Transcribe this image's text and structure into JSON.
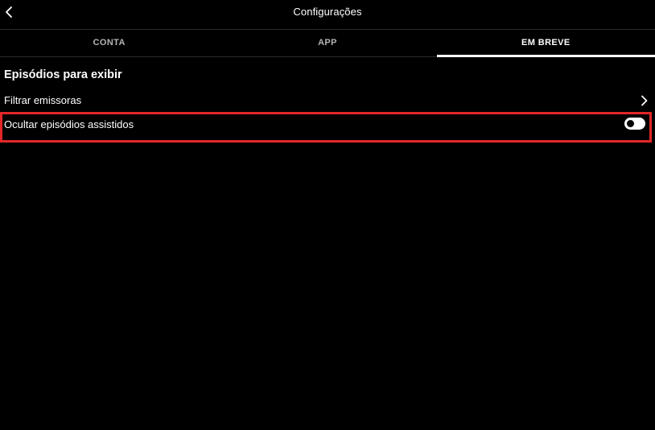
{
  "header": {
    "title": "Configurações",
    "back_icon": "chevron-left-icon"
  },
  "tabs": [
    {
      "label": "CONTA",
      "active": false
    },
    {
      "label": "APP",
      "active": false
    },
    {
      "label": "EM BREVE",
      "active": true
    }
  ],
  "section": {
    "title": "Episódios para exibir"
  },
  "settings": {
    "filter_label": "Filtrar emissoras",
    "filter_icon": "chevron-right-icon",
    "hide_watched_label": "Ocultar episódios assistidos",
    "hide_watched_enabled": false
  },
  "colors": {
    "background": "#000000",
    "highlight_border": "#e22727",
    "text": "#ffffff",
    "inactive_tab": "#b3b3b3"
  }
}
